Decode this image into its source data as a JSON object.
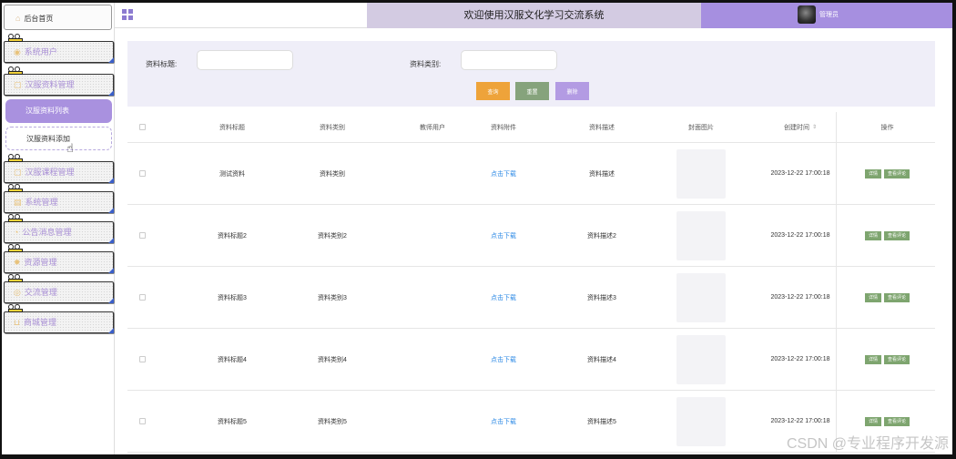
{
  "sidebar": {
    "home": "后台首页",
    "menu": [
      {
        "label": "系统用户"
      },
      {
        "label": "汉服资料管理"
      }
    ],
    "submenu": [
      {
        "label": "汉服资料列表"
      },
      {
        "label": "汉服资料添加"
      }
    ],
    "menu2": [
      {
        "label": "汉服课程管理"
      },
      {
        "label": "系统管理"
      },
      {
        "label": "公告消息管理"
      },
      {
        "label": "资源管理"
      },
      {
        "label": "交流管理"
      },
      {
        "label": "商城管理"
      }
    ]
  },
  "header": {
    "title": "欢迎使用汉服文化学习交流系统",
    "user": "管理员"
  },
  "search": {
    "title_label": "资料标题:",
    "type_label": "资料类别:",
    "query": "查询",
    "reset": "重置",
    "delete": "删除"
  },
  "table": {
    "columns": [
      "资料标题",
      "资料类别",
      "教师用户",
      "资料附件",
      "资料描述",
      "封面图片",
      "创建时间",
      "操作"
    ],
    "rows": [
      {
        "title": "测试资料",
        "type": "资料类别",
        "teacher": "",
        "attachment": "点击下载",
        "desc": "资料描述",
        "time": "2023-12-22 17:00:18"
      },
      {
        "title": "资料标题2",
        "type": "资料类别2",
        "teacher": "",
        "attachment": "点击下载",
        "desc": "资料描述2",
        "time": "2023-12-22 17:00:18"
      },
      {
        "title": "资料标题3",
        "type": "资料类别3",
        "teacher": "",
        "attachment": "点击下载",
        "desc": "资料描述3",
        "time": "2023-12-22 17:00:18"
      },
      {
        "title": "资料标题4",
        "type": "资料类别4",
        "teacher": "",
        "attachment": "点击下载",
        "desc": "资料描述4",
        "time": "2023-12-22 17:00:18"
      },
      {
        "title": "资料标题5",
        "type": "资料类别5",
        "teacher": "",
        "attachment": "点击下载",
        "desc": "资料描述5",
        "time": "2023-12-22 17:00:18"
      }
    ],
    "op_detail": "详情",
    "op_review": "查看评论"
  },
  "watermark": "CSDN @专业程序开发源",
  "icons": {
    "home": "home-icon",
    "grid": "grid-icon",
    "sort": "sort-icon"
  }
}
